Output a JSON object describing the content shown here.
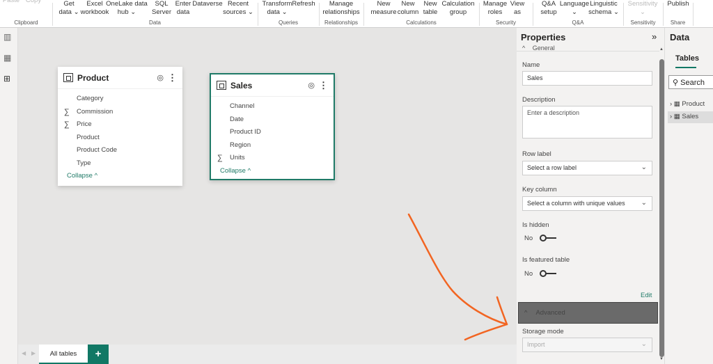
{
  "ribbon": {
    "buttons": [
      {
        "l1": "Paste",
        "l2": "",
        "disabled": true
      },
      {
        "l1": "Copy",
        "l2": "",
        "disabled": true
      },
      {
        "l1": "Get",
        "l2": "data ⌄"
      },
      {
        "l1": "Excel",
        "l2": "workbook"
      },
      {
        "l1": "OneLake data",
        "l2": "hub ⌄"
      },
      {
        "l1": "SQL",
        "l2": "Server"
      },
      {
        "l1": "Enter",
        "l2": "data"
      },
      {
        "l1": "Dataverse",
        "l2": ""
      },
      {
        "l1": "Recent",
        "l2": "sources ⌄"
      },
      {
        "l1": "Transform",
        "l2": "data ⌄"
      },
      {
        "l1": "Refresh",
        "l2": ""
      },
      {
        "l1": "Manage",
        "l2": "relationships"
      },
      {
        "l1": "New",
        "l2": "measure"
      },
      {
        "l1": "New",
        "l2": "column"
      },
      {
        "l1": "New",
        "l2": "table"
      },
      {
        "l1": "Calculation",
        "l2": "group"
      },
      {
        "l1": "Manage",
        "l2": "roles"
      },
      {
        "l1": "View",
        "l2": "as"
      },
      {
        "l1": "Q&A",
        "l2": "setup"
      },
      {
        "l1": "Language",
        "l2": "⌄"
      },
      {
        "l1": "Linguistic",
        "l2": "schema ⌄"
      },
      {
        "l1": "Sensitivity",
        "l2": "⌄",
        "disabled": true
      },
      {
        "l1": "Publish",
        "l2": ""
      }
    ],
    "groups": [
      "Clipboard",
      "Data",
      "Queries",
      "Relationships",
      "Calculations",
      "Security",
      "Q&A",
      "Sensitivity",
      "Share"
    ]
  },
  "tables": [
    {
      "name": "Product",
      "fields": [
        {
          "name": "Category",
          "sum": false
        },
        {
          "name": "Commission",
          "sum": true
        },
        {
          "name": "Price",
          "sum": true
        },
        {
          "name": "Product",
          "sum": false
        },
        {
          "name": "Product Code",
          "sum": false
        },
        {
          "name": "Type",
          "sum": false
        }
      ],
      "collapse": "Collapse ^"
    },
    {
      "name": "Sales",
      "fields": [
        {
          "name": "Channel",
          "sum": false
        },
        {
          "name": "Date",
          "sum": false
        },
        {
          "name": "Product ID",
          "sum": false
        },
        {
          "name": "Region",
          "sum": false
        },
        {
          "name": "Units",
          "sum": true
        }
      ],
      "collapse": "Collapse ^"
    }
  ],
  "bottom": {
    "tab": "All tables",
    "add": "+"
  },
  "properties": {
    "title": "Properties",
    "general": "General",
    "name_label": "Name",
    "name_value": "Sales",
    "desc_label": "Description",
    "desc_placeholder": "Enter a description",
    "row_label": "Row label",
    "row_placeholder": "Select a row label",
    "key_label": "Key column",
    "key_placeholder": "Select a column with unique values",
    "hidden_label": "Is hidden",
    "hidden_value": "No",
    "featured_label": "Is featured table",
    "featured_value": "No",
    "edit": "Edit",
    "advanced": "Advanced",
    "storage_label": "Storage mode",
    "storage_value": "Import"
  },
  "data_pane": {
    "title": "Data",
    "tab": "Tables",
    "search": "Search",
    "items": [
      "Product",
      "Sales"
    ]
  },
  "colors": {
    "accent": "#117865",
    "annotation": "#f26522"
  }
}
